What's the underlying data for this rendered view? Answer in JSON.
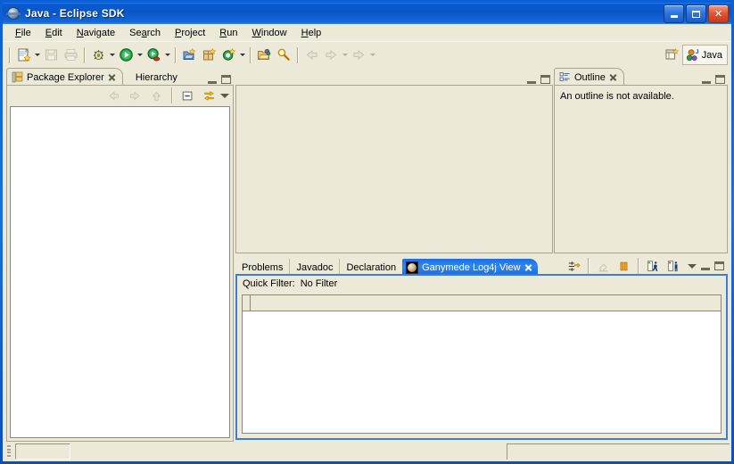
{
  "window": {
    "title": "Java - Eclipse SDK",
    "icon": "eclipse-sphere-icon",
    "buttons": {
      "minimize": "minimize",
      "maximize": "maximize",
      "close": "close"
    }
  },
  "menubar": {
    "items": [
      {
        "label": "File",
        "mnemonic": "F"
      },
      {
        "label": "Edit",
        "mnemonic": "E"
      },
      {
        "label": "Navigate",
        "mnemonic": "N"
      },
      {
        "label": "Search",
        "mnemonic": "a"
      },
      {
        "label": "Project",
        "mnemonic": "P"
      },
      {
        "label": "Run",
        "mnemonic": "R"
      },
      {
        "label": "Window",
        "mnemonic": "W"
      },
      {
        "label": "Help",
        "mnemonic": "H"
      }
    ]
  },
  "toolbar": {
    "items": [
      {
        "name": "new-wizard-button",
        "tooltip": "New"
      },
      {
        "name": "new-wizard-dropdown",
        "tooltip": "New dropdown"
      },
      {
        "name": "save-button",
        "tooltip": "Save",
        "enabled": false
      },
      {
        "name": "print-button",
        "tooltip": "Print",
        "enabled": false
      },
      {
        "name": "debug-button",
        "tooltip": "Debug"
      },
      {
        "name": "debug-dropdown",
        "tooltip": "Debug dropdown"
      },
      {
        "name": "run-button",
        "tooltip": "Run"
      },
      {
        "name": "run-dropdown",
        "tooltip": "Run dropdown"
      },
      {
        "name": "external-tools-button",
        "tooltip": "External Tools"
      },
      {
        "name": "external-tools-dropdown",
        "tooltip": "External Tools dropdown"
      },
      {
        "name": "new-java-project-button",
        "tooltip": "New Java Project"
      },
      {
        "name": "new-java-package-button",
        "tooltip": "New Java Package"
      },
      {
        "name": "new-java-class-button",
        "tooltip": "New Java Class"
      },
      {
        "name": "new-java-class-dropdown",
        "tooltip": "New Java Class dropdown"
      },
      {
        "name": "open-type-button",
        "tooltip": "Open Type"
      },
      {
        "name": "search-button",
        "tooltip": "Search"
      },
      {
        "name": "back-button",
        "tooltip": "Back",
        "enabled": false
      },
      {
        "name": "forward-button",
        "tooltip": "Forward",
        "enabled": false
      },
      {
        "name": "forward-dropdown",
        "tooltip": "Forward dropdown",
        "enabled": false
      },
      {
        "name": "next-annotation-button",
        "tooltip": "Next Annotation",
        "enabled": false
      },
      {
        "name": "next-annotation-dropdown",
        "tooltip": "Next Annotation dropdown",
        "enabled": false
      }
    ],
    "perspective": {
      "open_perspective_tooltip": "Open Perspective",
      "active_label": "Java"
    }
  },
  "package_explorer": {
    "tabs": [
      {
        "label": "Package Explorer",
        "active": true,
        "closable": true,
        "icon": "package-explorer-icon"
      },
      {
        "label": "Hierarchy",
        "active": false,
        "closable": false
      }
    ],
    "toolbar": [
      {
        "name": "back-button",
        "enabled": false
      },
      {
        "name": "forward-button",
        "enabled": false
      },
      {
        "name": "up-button",
        "enabled": false
      },
      {
        "name": "collapse-all-button",
        "enabled": true
      },
      {
        "name": "link-with-editor-button",
        "enabled": true
      },
      {
        "name": "view-menu-button",
        "enabled": true
      }
    ],
    "controls": {
      "minimize": "minimize",
      "maximize": "maximize"
    },
    "tree_items": []
  },
  "editor_area": {
    "tabs": [],
    "controls": {
      "minimize": "minimize",
      "maximize": "maximize"
    }
  },
  "outline": {
    "tabs": [
      {
        "label": "Outline",
        "active": true,
        "closable": true,
        "icon": "outline-icon"
      }
    ],
    "message": "An outline is not available.",
    "controls": {
      "minimize": "minimize",
      "maximize": "maximize"
    }
  },
  "log_view": {
    "tabs": [
      {
        "label": "Problems",
        "active": false
      },
      {
        "label": "Javadoc",
        "active": false
      },
      {
        "label": "Declaration",
        "active": false
      },
      {
        "label": "Ganymede Log4j View",
        "active": true,
        "closable": true,
        "icon": "ganymede-moon-icon"
      }
    ],
    "toolbar": [
      {
        "name": "scroll-lock-button",
        "enabled": true
      },
      {
        "name": "clear-log-button",
        "enabled": false
      },
      {
        "name": "pause-button",
        "enabled": true
      },
      {
        "name": "start-monitor-button",
        "enabled": true
      },
      {
        "name": "stop-monitor-button",
        "enabled": true
      },
      {
        "name": "view-menu-button",
        "enabled": true
      }
    ],
    "quick_filter": {
      "label": "Quick Filter:",
      "value": "No Filter"
    },
    "columns": [
      {
        "label": ""
      },
      {
        "label": ""
      }
    ],
    "rows": [],
    "controls": {
      "minimize": "minimize",
      "maximize": "maximize"
    }
  },
  "statusbar": {
    "left": "",
    "right": ""
  }
}
